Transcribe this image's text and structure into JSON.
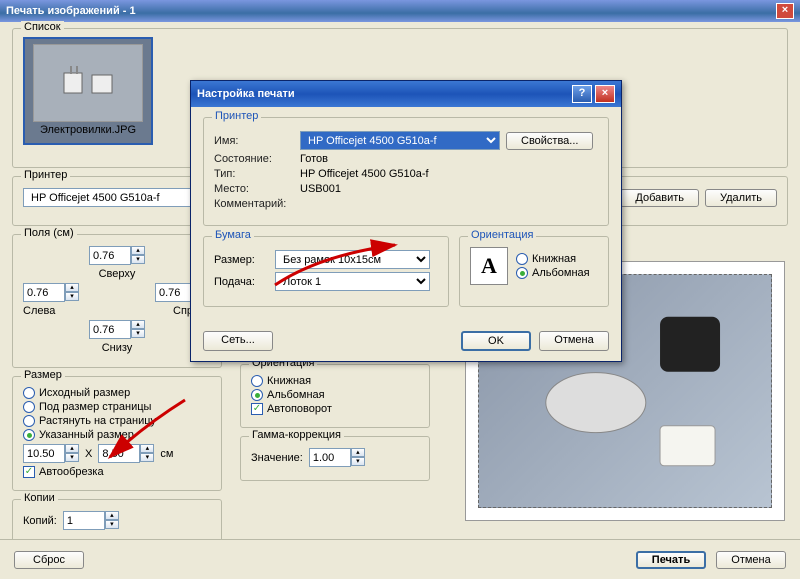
{
  "window": {
    "title": "Печать изображений - 1"
  },
  "list": {
    "label": "Список",
    "thumb_caption": "Электровилки.JPG"
  },
  "printer": {
    "label": "Принтер",
    "value": "HP Officejet 4500 G510a-f",
    "add": "Добавить",
    "remove": "Удалить"
  },
  "margins": {
    "label": "Поля (см)",
    "top_label": "Сверху",
    "top": "0.76",
    "left_label": "Слева",
    "left": "0.76",
    "right_label": "Справа",
    "right": "0.76",
    "bottom_label": "Снизу",
    "bottom": "0.76"
  },
  "size": {
    "label": "Размер",
    "opt1": "Исходный размер",
    "opt2": "Под размер страницы",
    "opt3": "Растянуть на страницу",
    "opt4": "Указанный размер",
    "w": "10.50",
    "x": "X",
    "h": "8.50",
    "unit": "см",
    "autocrop": "Автообрезка"
  },
  "copies": {
    "label": "Копии",
    "field_label": "Копий:",
    "value": "1"
  },
  "orientation_panel": {
    "label": "Ориентация",
    "portrait": "Книжная",
    "landscape": "Альбомная",
    "autorotate": "Автоповорот"
  },
  "gamma": {
    "label": "Гамма-коррекция",
    "value_label": "Значение:",
    "value": "1.00"
  },
  "buttons": {
    "reset": "Сброс",
    "print": "Печать",
    "cancel": "Отмена"
  },
  "dialog": {
    "title": "Настройка печати",
    "printer_group": "Принтер",
    "name_label": "Имя:",
    "name_value": "HP Officejet 4500 G510a-f",
    "props": "Свойства...",
    "state_label": "Состояние:",
    "state_value": "Готов",
    "type_label": "Тип:",
    "type_value": "HP Officejet 4500 G510a-f",
    "where_label": "Место:",
    "where_value": "USB001",
    "comment_label": "Комментарий:",
    "paper_group": "Бумага",
    "size_label": "Размер:",
    "size_value": "Без рамок 10x15см",
    "source_label": "Подача:",
    "source_value": "Лоток 1",
    "orient_group": "Ориентация",
    "orient_portrait": "Книжная",
    "orient_landscape": "Альбомная",
    "network": "Сеть...",
    "ok": "OK",
    "cancel": "Отмена"
  }
}
